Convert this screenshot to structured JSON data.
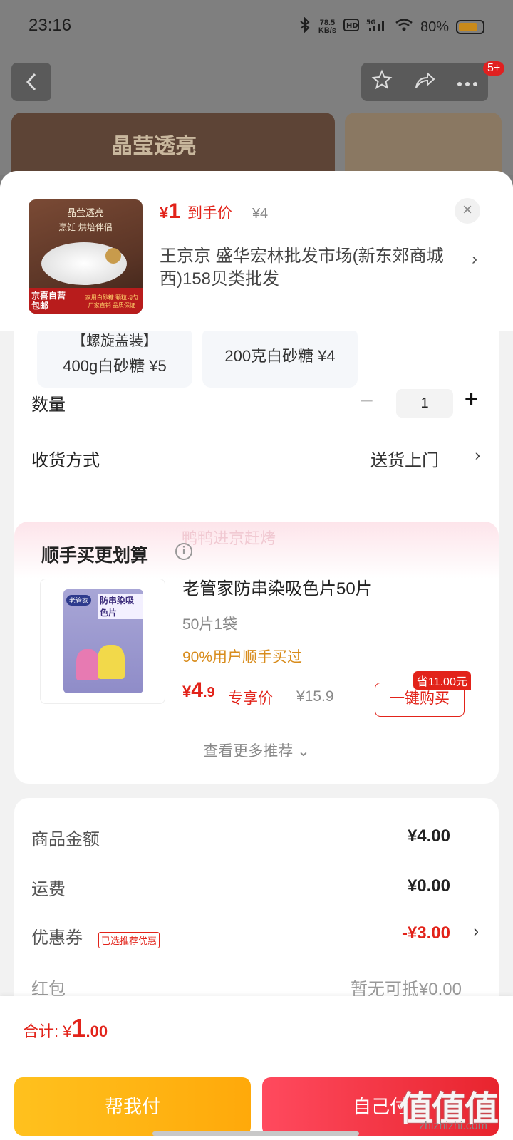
{
  "status_bar": {
    "time": "23:16",
    "net_speed_value": "78.5",
    "net_speed_unit": "KB/s",
    "battery": "80%",
    "icons": [
      "bluetooth-icon",
      "hd-icon",
      "5g-signal-icon",
      "wifi-icon",
      "battery-icon"
    ]
  },
  "nav": {
    "badge": "5+",
    "icons": [
      "back-icon",
      "star-icon",
      "share-icon",
      "more-icon"
    ]
  },
  "background": {
    "banner_text": "晶莹透亮"
  },
  "header": {
    "thumb": {
      "line1": "晶莹透亮",
      "line2": "烹饪  烘培伴侣",
      "foot_left_1": "京喜自营",
      "foot_left_2": "包邮",
      "foot_right_1": "家用白砂糖  颗粒均匀",
      "foot_right_2": "厂家直销  品质保证"
    },
    "price": "1",
    "price_currency": "¥",
    "price_tag": "到手价",
    "original_price": "¥4",
    "address": "王京京  盛华宏林批发市场(新东郊商城西)158贝类批发"
  },
  "options": [
    {
      "line1": "【螺旋盖装】",
      "line2": "400g白砂糖 ¥5"
    },
    {
      "line1": "200克白砂糖 ¥4"
    }
  ],
  "quantity": {
    "label": "数量",
    "value": "1"
  },
  "delivery": {
    "label": "收货方式",
    "value": "送货上门"
  },
  "cross_sell": {
    "watermark": "鸭鸭进京赶烤",
    "title": "顺手买更划算",
    "product": {
      "name": "老管家防串染吸色片50片",
      "spec": "50片1袋",
      "hint": "90%用户顺手买过",
      "price_currency": "¥",
      "price_int": "4",
      "price_dec": ".9",
      "price_tag": "专享价",
      "original_price": "¥15.9",
      "save_badge": "省11.00元",
      "buy_label": "一键购买",
      "pack_logo": "老管家",
      "pack_title": "防串染吸色片"
    },
    "more_label": "查看更多推荐"
  },
  "summary": {
    "rows": [
      {
        "label": "商品金额",
        "value": "¥4.00"
      },
      {
        "label": "运费",
        "value": "¥0.00"
      },
      {
        "label": "优惠券",
        "tag": "已选推荐优惠",
        "value": "-¥3.00"
      }
    ],
    "cut_label": "红包",
    "cut_value": "暂无可抵¥0.00"
  },
  "bottom": {
    "total_label": "合计: ¥",
    "total_int": "1",
    "total_dec": ".00",
    "help_pay": "帮我付",
    "self_pay": "自己付",
    "watermark": "值值值",
    "watermark_sub": "zhizhizhi.com"
  },
  "colors": {
    "accent_red": "#e2231a",
    "help_yellow": "#ffb414",
    "hint_orange": "#d88c1c"
  }
}
